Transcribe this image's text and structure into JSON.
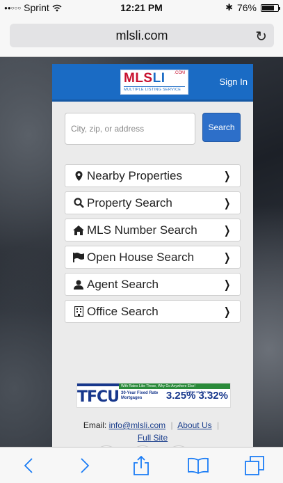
{
  "status_bar": {
    "carrier": "Sprint",
    "time": "12:21 PM",
    "battery": "76%",
    "battery_level": 0.76
  },
  "browser": {
    "url": "mlsli.com"
  },
  "site": {
    "logo_text_a": "MLS",
    "logo_text_b": "LI",
    "logo_com": ".COM",
    "logo_tagline": "MULTIPLE LISTING SERVICE",
    "sign_in": "Sign In",
    "search_placeholder": "City, zip, or address",
    "search_button": "Search",
    "menu": [
      {
        "label": "Nearby Properties",
        "icon": "map-pin-icon"
      },
      {
        "label": "Property Search",
        "icon": "magnifier-icon"
      },
      {
        "label": "MLS Number Search",
        "icon": "home-icon"
      },
      {
        "label": "Open House Search",
        "icon": "flag-icon"
      },
      {
        "label": "Agent Search",
        "icon": "user-icon"
      },
      {
        "label": "Office Search",
        "icon": "building-icon"
      }
    ]
  },
  "ad": {
    "brand": "TFCU",
    "tagline": "With Rates Like These, Why Go Anywhere Else!",
    "product": "30-Year Fixed Rate Mortgages",
    "as_low_as": "Rates as low as",
    "rate": "3.25%",
    "apr": "3.32%"
  },
  "footer": {
    "email_label": "Email:",
    "email": "info@mlsli.com",
    "about": "About Us",
    "full_site": "Full Site"
  },
  "colors": {
    "header_blue": "#1a6bc4",
    "ios_tint": "#1a7cf5",
    "logo_red": "#c8102e"
  }
}
